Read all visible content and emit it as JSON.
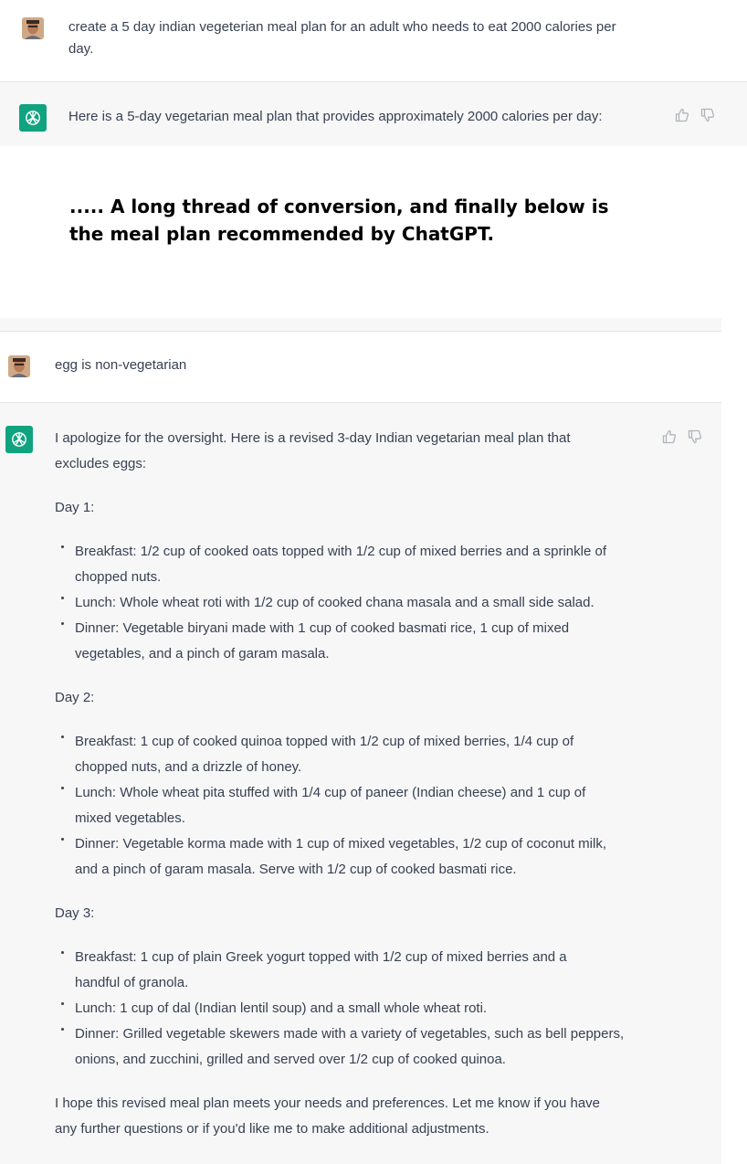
{
  "conversation": {
    "first_prompt": {
      "author": "user",
      "lines": [
        "create a 5 day indian vegeterian meal plan for an adult who needs to eat 2000 calories per",
        "day."
      ]
    },
    "first_reply": {
      "author": "assistant",
      "text": "Here is a 5-day vegetarian meal plan that provides approximately 2000 calories per day:"
    },
    "annotation": {
      "lines": [
        ".....  A long thread of conversion, and finally below is",
        "the meal plan recommended by ChatGPT."
      ]
    },
    "followup_prompt": {
      "author": "user",
      "text": "egg is non-vegetarian"
    },
    "final_reply": {
      "author": "assistant",
      "intro_lines": [
        "I apologize for the oversight. Here is a revised 3-day Indian vegetarian meal plan that",
        "excludes eggs:"
      ],
      "days": [
        {
          "label": "Day 1:",
          "meals": [
            {
              "lines": [
                "Breakfast: 1/2 cup of cooked oats topped with 1/2 cup of mixed berries and a sprinkle of",
                "chopped nuts."
              ]
            },
            {
              "lines": [
                "Lunch: Whole wheat roti with 1/2 cup of cooked chana masala and a small side salad."
              ]
            },
            {
              "lines": [
                "Dinner: Vegetable biryani made with 1 cup of cooked basmati rice, 1 cup of mixed",
                "vegetables, and a pinch of garam masala."
              ]
            }
          ]
        },
        {
          "label": "Day 2:",
          "meals": [
            {
              "lines": [
                "Breakfast: 1 cup of cooked quinoa topped with 1/2 cup of mixed berries, 1/4 cup of",
                "chopped nuts, and a drizzle of honey."
              ]
            },
            {
              "lines": [
                "Lunch: Whole wheat pita stuffed with 1/4 cup of paneer (Indian cheese) and 1 cup of",
                "mixed vegetables."
              ]
            },
            {
              "lines": [
                "Dinner: Vegetable korma made with 1 cup of mixed vegetables, 1/2 cup of coconut milk,",
                "and a pinch of garam masala. Serve with 1/2 cup of cooked basmati rice."
              ]
            }
          ]
        },
        {
          "label": "Day 3:",
          "meals": [
            {
              "lines": [
                "Breakfast: 1 cup of plain Greek yogurt topped with 1/2 cup of mixed berries and a",
                "handful of granola."
              ]
            },
            {
              "lines": [
                "Lunch: 1 cup of dal (Indian lentil soup) and a small whole wheat roti."
              ]
            },
            {
              "lines": [
                "Dinner: Grilled vegetable skewers made with a variety of vegetables, such as bell peppers,",
                "onions, and zucchini, grilled and served over 1/2 cup of cooked quinoa."
              ]
            }
          ]
        }
      ],
      "closing_lines": [
        "I hope this revised meal plan meets your needs and preferences. Let me know if you have",
        "any further questions or if you'd like me to make additional adjustments."
      ]
    }
  },
  "icons": {
    "user_avatar": "user-avatar",
    "assistant_logo": "openai-logo-icon",
    "thumbs_up": "thumbs-up-icon",
    "thumbs_down": "thumbs-down-icon"
  },
  "colors": {
    "assistant_bg": "#f7f7f8",
    "logo_bg": "#10a37f",
    "text": "#374151",
    "icon_gray": "#b0b4bb"
  }
}
